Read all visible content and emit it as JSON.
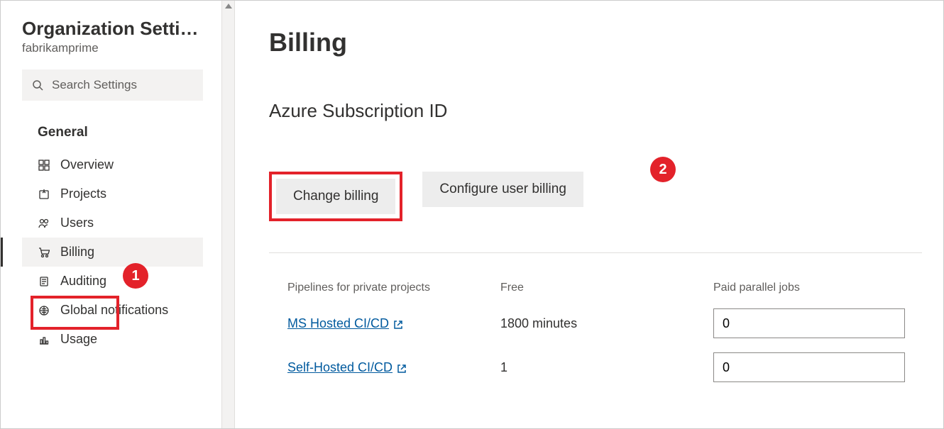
{
  "sidebar": {
    "title": "Organization Settin…",
    "subtitle": "fabrikamprime",
    "search_placeholder": "Search Settings",
    "section_label": "General",
    "items": [
      {
        "label": "Overview"
      },
      {
        "label": "Projects"
      },
      {
        "label": "Users"
      },
      {
        "label": "Billing"
      },
      {
        "label": "Auditing"
      },
      {
        "label": "Global notifications"
      },
      {
        "label": "Usage"
      }
    ]
  },
  "callouts": {
    "one": "1",
    "two": "2"
  },
  "main": {
    "title": "Billing",
    "subscription_heading": "Azure Subscription ID",
    "buttons": {
      "change_billing": "Change billing",
      "configure_user_billing": "Configure user billing"
    },
    "pipelines": {
      "headers": {
        "col1": "Pipelines for private projects",
        "col2": "Free",
        "col3": "Paid parallel jobs"
      },
      "rows": [
        {
          "name": "MS Hosted CI/CD",
          "free": "1800 minutes",
          "paid": "0"
        },
        {
          "name": "Self-Hosted CI/CD",
          "free": "1",
          "paid": "0"
        }
      ]
    }
  }
}
